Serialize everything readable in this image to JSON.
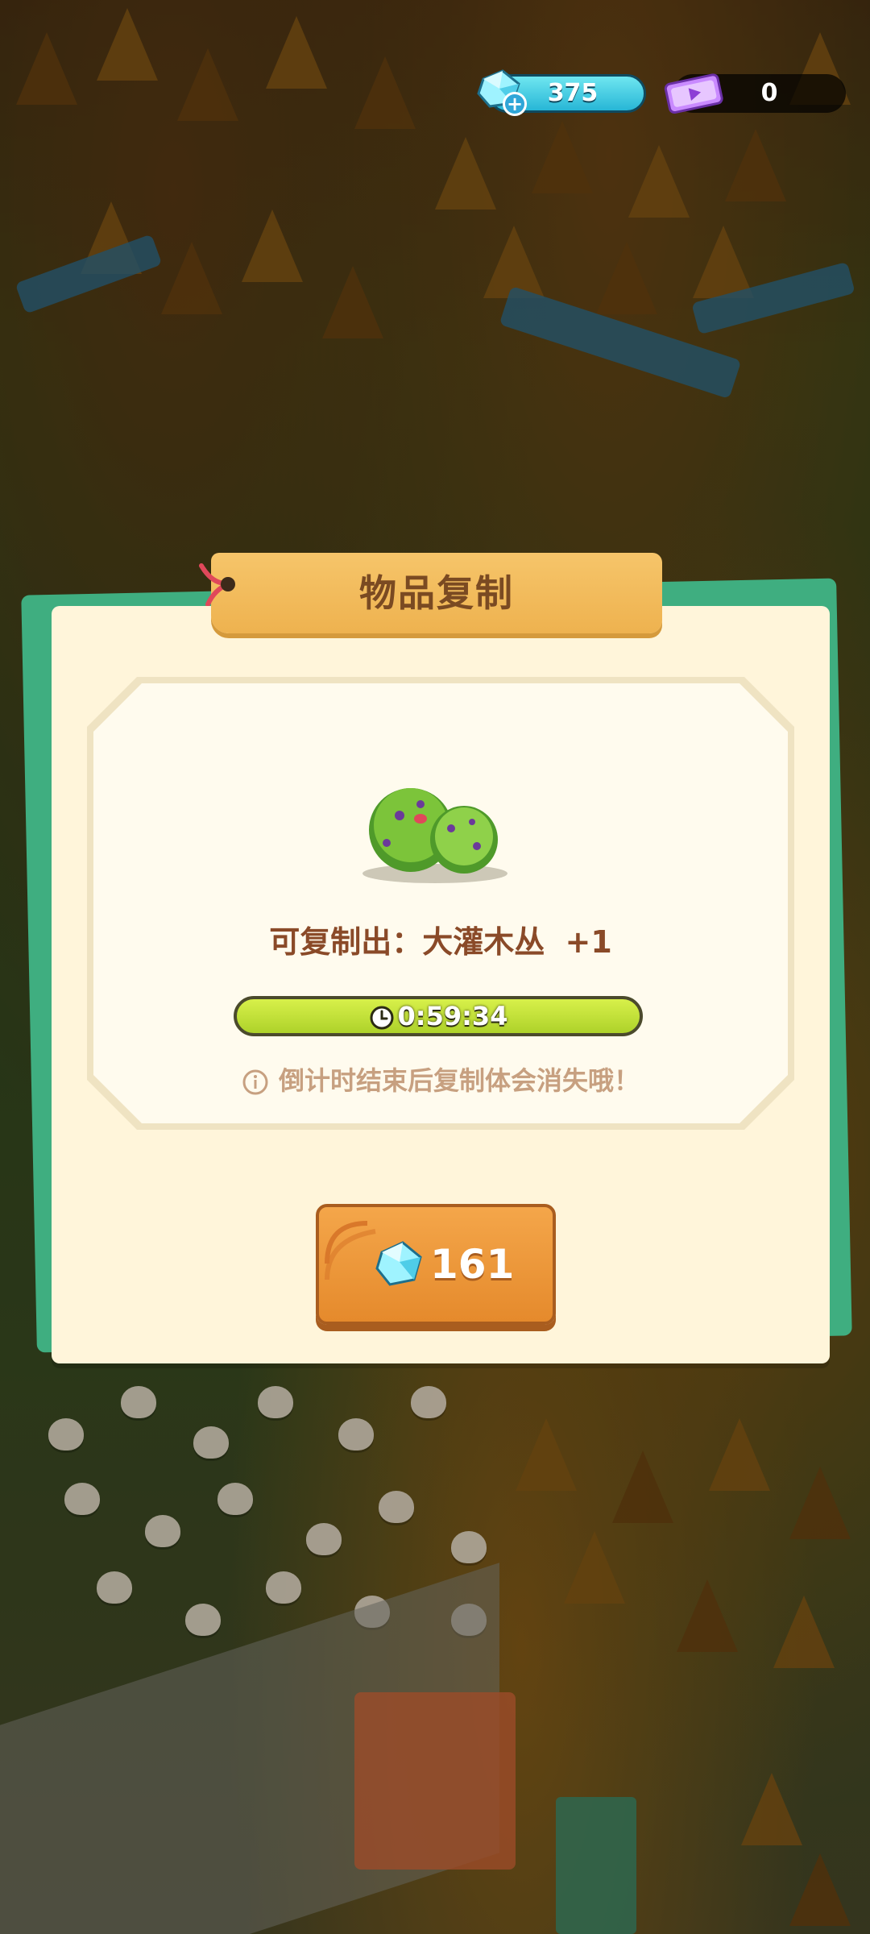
{
  "currency": {
    "gems": "375",
    "tickets": "0"
  },
  "dialog": {
    "title": "物品复制",
    "copy_label": "可复制出：大灌木丛",
    "copy_amount": "+1",
    "timer": "0:59:34",
    "note": "倒计时结束后复制体会消失哦！",
    "price": "161"
  },
  "colors": {
    "dialog_bg": "#fff5da",
    "title_ribbon": "#f6c56a",
    "timer_fill": "#c6e43a",
    "button": "#e58a2c",
    "gem_pill": "#27b6d6"
  },
  "icons": {
    "gem": "gem-icon",
    "ticket": "ticket-icon",
    "clock": "clock-icon",
    "info": "info-icon",
    "bush": "bush-item-icon"
  }
}
